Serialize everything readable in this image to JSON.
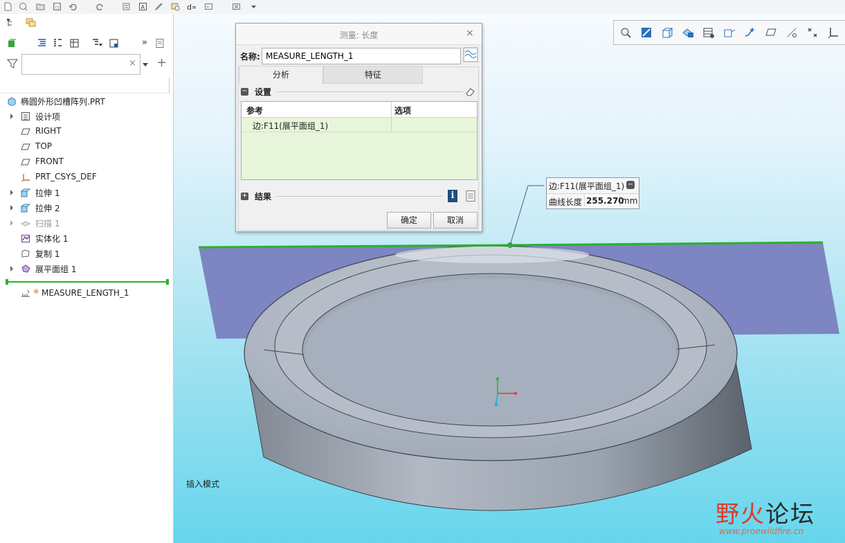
{
  "app": {
    "toolbar_icons": [
      "new-file-icon",
      "open-file-icon",
      "save-icon",
      "undo-icon",
      "redo-icon",
      "regenerate-icon",
      "annotation-icon",
      "settings-icon",
      "dimension-icon",
      "window-icon",
      "close-window-icon",
      "dropdown-icon"
    ]
  },
  "model_tree": {
    "search_placeholder": "",
    "root_label": "椭圆外形凹槽阵列.PRT",
    "items": [
      {
        "label": "设计项",
        "icon": "design-item-icon",
        "expandable": true
      },
      {
        "label": "RIGHT",
        "icon": "datum-plane-icon",
        "expandable": false
      },
      {
        "label": "TOP",
        "icon": "datum-plane-icon",
        "expandable": false
      },
      {
        "label": "FRONT",
        "icon": "datum-plane-icon",
        "expandable": false
      },
      {
        "label": "PRT_CSYS_DEF",
        "icon": "csys-icon",
        "expandable": false
      },
      {
        "label": "拉伸 1",
        "icon": "extrude-icon",
        "expandable": true
      },
      {
        "label": "拉伸 2",
        "icon": "extrude-icon",
        "expandable": true
      },
      {
        "label": "扫描 1",
        "icon": "sweep-icon",
        "expandable": true,
        "dimmed": true
      },
      {
        "label": "实体化 1",
        "icon": "solidify-icon",
        "expandable": false
      },
      {
        "label": "复制 1",
        "icon": "copy-icon",
        "expandable": false
      },
      {
        "label": "展平面组 1",
        "icon": "flatten-quilt-icon",
        "expandable": true
      }
    ],
    "measure_item": "MEASURE_LENGTH_1"
  },
  "dialog": {
    "title": "测量: 长度",
    "name_label": "名称:",
    "name_value": "MEASURE_LENGTH_1",
    "tabs": [
      "分析",
      "特征"
    ],
    "settings_label": "设置",
    "col_reference": "参考",
    "col_options": "选项",
    "reference_value": "边:F11(展平面组_1)",
    "results_label": "结果",
    "ok_label": "确定",
    "cancel_label": "取消"
  },
  "callout": {
    "edge_label": "边:F11(展平面组_1)",
    "length_label": "曲线长度",
    "length_value": "255.270",
    "unit": "mm"
  },
  "viewport": {
    "mode_text": "插入模式",
    "watermark_title_red": "野火",
    "watermark_title_dark": "论坛",
    "watermark_url": "www.proewildfire.cn"
  },
  "colors": {
    "accent_green": "#27b32a",
    "flat_quilt": "#7e86c3",
    "part_gray": "#a4adba"
  }
}
